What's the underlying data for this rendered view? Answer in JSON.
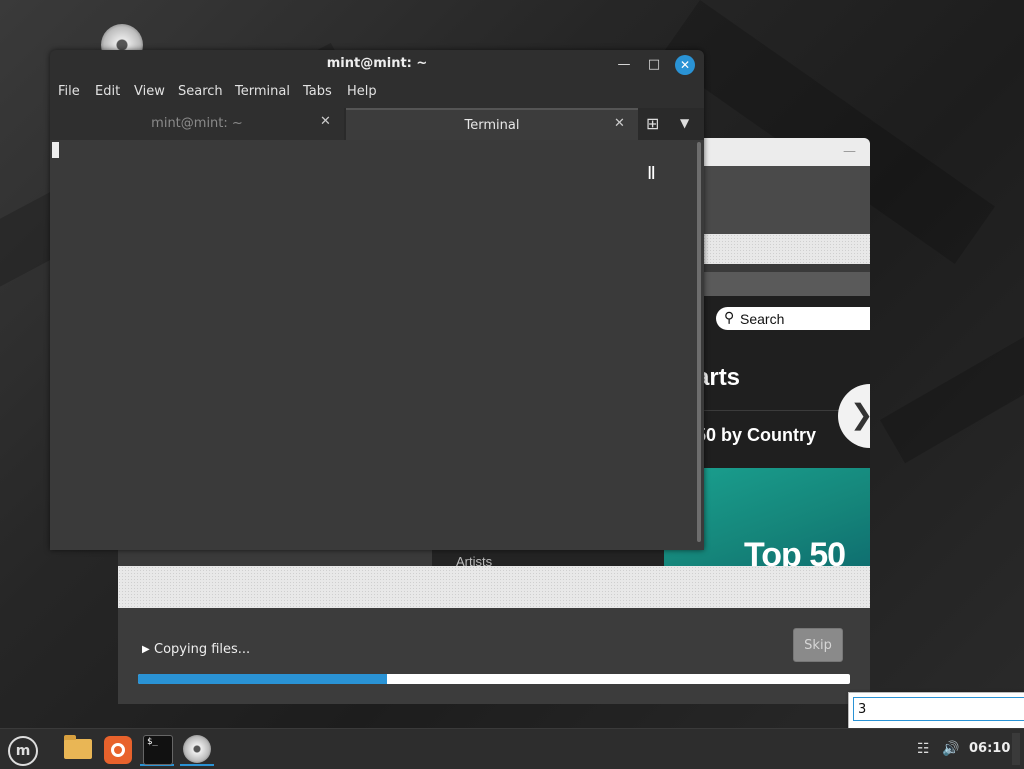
{
  "desktop": {
    "icon": "disc-icon"
  },
  "installer": {
    "search_placeholder": "Search",
    "web_heading": "arts",
    "web_subheading": "50 by Country",
    "web_card_title": "Top 50",
    "web_sidebar_item": "Artists",
    "status_text": "Copying files...",
    "skip_label": "Skip",
    "progress_fraction": 0.35
  },
  "terminal": {
    "title": "mint@mint: ~",
    "menu": [
      "File",
      "Edit",
      "View",
      "Search",
      "Terminal",
      "Tabs",
      "Help"
    ],
    "tabs": [
      {
        "label": "mint@mint: ~",
        "active": false
      },
      {
        "label": "Terminal",
        "active": true
      }
    ]
  },
  "input_popup": {
    "value": "3"
  },
  "taskbar": {
    "apps": [
      "mint-menu-icon",
      "files-icon",
      "firefox-icon",
      "terminal-icon",
      "disc-icon"
    ],
    "clock": "06:10"
  },
  "colors": {
    "accent": "#2a93d5",
    "progress_bg": "#ffffff"
  }
}
